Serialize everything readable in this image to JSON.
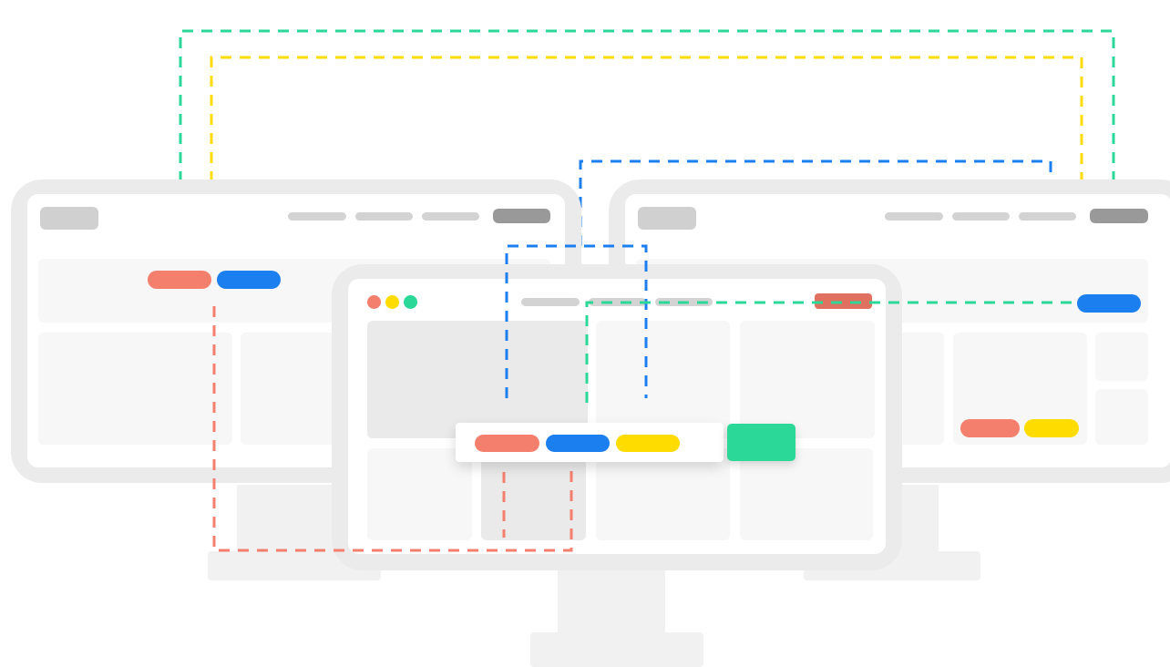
{
  "colors": {
    "coral": "#f47f6d",
    "blue": "#1c7ff0",
    "yellow": "#fedc00",
    "green": "#2bd898",
    "red_button": "#e0705f",
    "frame_gray": "#ebebeb",
    "placeholder": "#f7f7f7",
    "placeholder_dark": "#eaeaea",
    "nav_gray": "#d3d3d3",
    "nav_button_gray": "#999999",
    "stand_gray": "#f1f1f1"
  },
  "icons": {
    "window_dots": [
      "close-dot",
      "minimize-dot",
      "maximize-dot"
    ]
  },
  "connectors": [
    {
      "name": "green-connector-outer",
      "color": "green"
    },
    {
      "name": "yellow-connector-outer",
      "color": "yellow"
    },
    {
      "name": "blue-connector-right",
      "color": "blue"
    },
    {
      "name": "blue-connector-center",
      "color": "blue"
    },
    {
      "name": "green-connector-center",
      "color": "green"
    },
    {
      "name": "coral-connector-left",
      "color": "coral"
    },
    {
      "name": "coral-connector-short",
      "color": "coral"
    }
  ]
}
